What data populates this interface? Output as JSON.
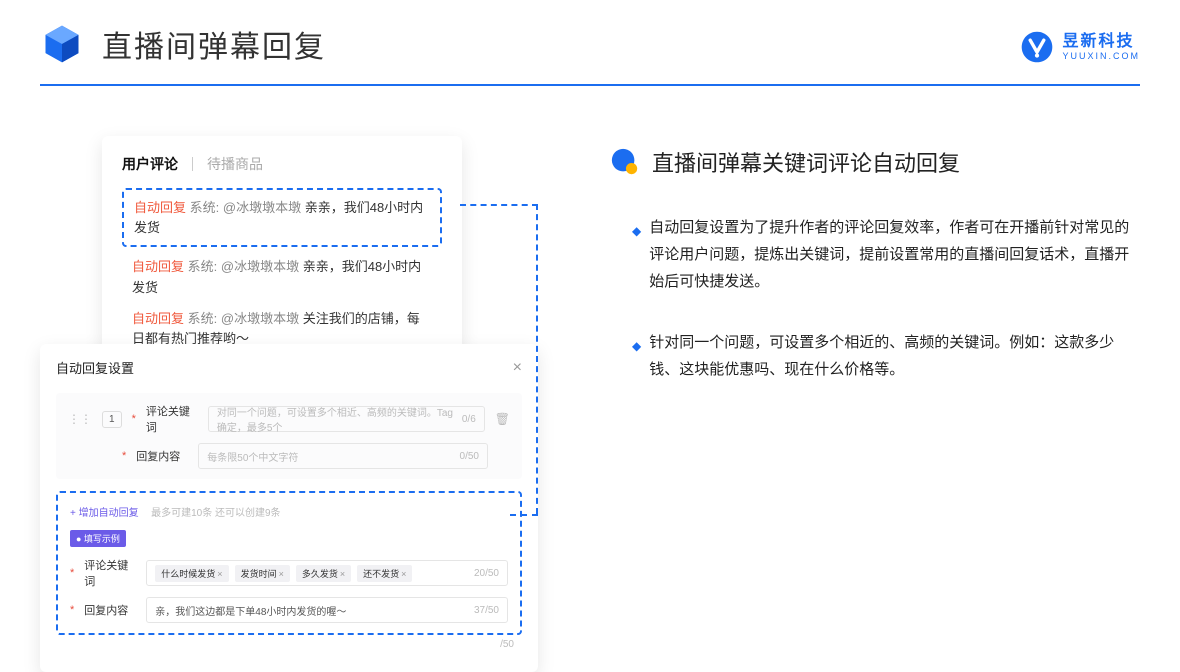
{
  "header": {
    "title": "直播间弹幕回复",
    "logo_cn": "昱新科技",
    "logo_en": "YUUXIN.COM"
  },
  "card1": {
    "tab_active": "用户评论",
    "tab_inactive": "待播商品",
    "auto_tag": "自动回复",
    "sys": "系统:",
    "msg1_user": "@冰墩墩本墩",
    "msg1_text": "亲亲，我们48小时内发货",
    "msg2_user": "@冰墩墩本墩",
    "msg2_text": "亲亲，我们48小时内发货",
    "msg3_user": "@冰墩墩本墩",
    "msg3_text": "关注我们的店铺，每日都有热门推荐哟～"
  },
  "card2": {
    "title": "自动回复设置",
    "close": "×",
    "badge": "1",
    "label_kw": "评论关键词",
    "placeholder_kw": "对同一个问题，可设置多个相近、高频的关键词。Tag确定，最多5个",
    "count_kw": "0/6",
    "label_reply": "回复内容",
    "placeholder_reply": "每条限50个中文字符",
    "count_reply": "0/50",
    "add_label": "+ 增加自动回复",
    "add_hint": "最多可建10条 还可以创建9条",
    "example_tag": "● 填写示例",
    "tag1": "什么时候发货",
    "tag2": "发货时间",
    "tag3": "多久发货",
    "tag4": "还不发货",
    "tag_count": "20/50",
    "example_reply": "亲，我们这边都是下单48小时内发货的喔～",
    "example_reply_count": "37/50",
    "lower_count": "/50"
  },
  "right": {
    "title": "直播间弹幕关键词评论自动回复",
    "bullet1": "自动回复设置为了提升作者的评论回复效率，作者可在开播前针对常见的评论用户问题，提炼出关键词，提前设置常用的直播间回复话术，直播开始后可快捷发送。",
    "bullet2": "针对同一个问题，可设置多个相近的、高频的关键词。例如：这款多少钱、这块能优惠吗、现在什么价格等。"
  }
}
